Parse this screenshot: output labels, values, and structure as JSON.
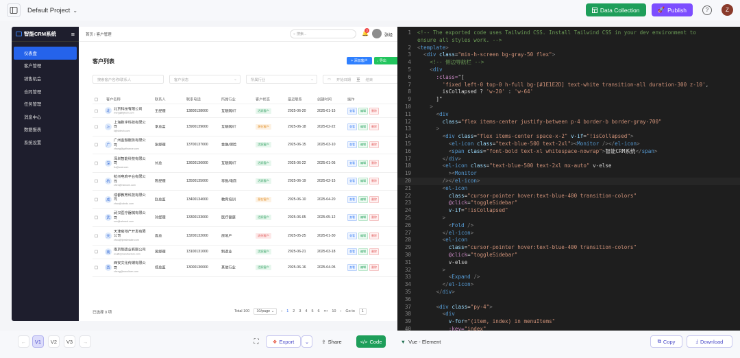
{
  "topbar": {
    "project": "Default Project",
    "data_collection": "Data Collection",
    "publish": "Publish",
    "help": "?",
    "user_initial": "Z"
  },
  "preview": {
    "app_title": "智能CRM系统",
    "menu": [
      "仪表盘",
      "客户管理",
      "销售机会",
      "合同管理",
      "任务管理",
      "消息中心",
      "数据报表",
      "系统设置"
    ],
    "breadcrumb": "首页  /  客户管理",
    "search_placeholder": "搜索...",
    "bell_count": "3",
    "user_name": "张经",
    "page_title": "客户列表",
    "add_customer": "+ 添加客户",
    "export_short": "↓ 导出",
    "filters": {
      "keyword_placeholder": "搜索客户名称/联系人",
      "status_placeholder": "客户状态",
      "industry_placeholder": "所属行业",
      "start_date": "开始日期",
      "to": "至",
      "end_date": "结束"
    },
    "columns": [
      "客户名称",
      "联系人",
      "联系电话",
      "所属行业",
      "客户状态",
      "最近联系",
      "创建时间",
      "操作"
    ],
    "rows": [
      {
        "avatar": "北",
        "name": "北京科技有限公司",
        "email": "wang@bjtech.com",
        "contact": "王经理",
        "phone": "13800138000",
        "industry": "互联网/IT",
        "status": "活跃客户",
        "status_type": "green",
        "last": "2025-06-20",
        "created": "2025-01-15"
      },
      {
        "avatar": "上",
        "name": "上海数字科技有限公司",
        "email": "li@shtech.com",
        "contact": "李总监",
        "phone": "13900139000",
        "industry": "互联网/IT",
        "status": "潜在客户",
        "status_type": "orange",
        "last": "2025-06-18",
        "created": "2025-02-22"
      },
      {
        "avatar": "广",
        "name": "广州金融服务有限公司",
        "email": "zhang@gzfinance.com",
        "contact": "张经理",
        "phone": "13700137000",
        "industry": "金融/保险",
        "status": "活跃客户",
        "status_type": "green",
        "last": "2025-06-15",
        "created": "2025-03-10"
      },
      {
        "avatar": "深",
        "name": "深圳智能科技有限公司",
        "email": "liu@szai.com",
        "contact": "刘总",
        "phone": "13600136000",
        "industry": "互联网/IT",
        "status": "活跃客户",
        "status_type": "green",
        "last": "2025-06-22",
        "created": "2025-01-05"
      },
      {
        "avatar": "杭",
        "name": "杭州电商平台有限公司",
        "email": "chen@hzecom.com",
        "contact": "陈经理",
        "phone": "13500135000",
        "industry": "零售/电商",
        "status": "活跃客户",
        "status_type": "green",
        "last": "2025-06-19",
        "created": "2025-02-15"
      },
      {
        "avatar": "成",
        "name": "成都教育科技有限公司",
        "email": "zhao@cdedu.com",
        "contact": "赵总监",
        "phone": "13400134000",
        "industry": "教育培训",
        "status": "潜在客户",
        "status_type": "orange",
        "last": "2025-06-10",
        "created": "2025-04-20"
      },
      {
        "avatar": "武",
        "name": "武汉医疗器械有限公司",
        "email": "sun@whmed.com",
        "contact": "孙经理",
        "phone": "13300133000",
        "industry": "医疗健康",
        "status": "活跃客户",
        "status_type": "green",
        "last": "2025-06-05",
        "created": "2025-05-12"
      },
      {
        "avatar": "天",
        "name": "天津房地产开发有限公司",
        "email": "zhou@tjrealestate.com",
        "contact": "周总",
        "phone": "13200132000",
        "industry": "房地产",
        "status": "流失客户",
        "status_type": "red",
        "last": "2025-05-25",
        "created": "2025-01-30"
      },
      {
        "avatar": "南",
        "name": "南京制造业有限公司",
        "email": "wu@njmanufacture.com",
        "contact": "吴经理",
        "phone": "13100131000",
        "industry": "制造业",
        "status": "活跃客户",
        "status_type": "green",
        "last": "2025-06-21",
        "created": "2025-03-18"
      },
      {
        "avatar": "西",
        "name": "西安文化传媒有限公司",
        "email": "zheng@xaculture.com",
        "contact": "郑总监",
        "phone": "13000130000",
        "industry": "其他行业",
        "status": "活跃客户",
        "status_type": "green",
        "last": "2025-06-16",
        "created": "2025-04-05"
      }
    ],
    "ops": {
      "view": "查看",
      "edit": "编辑",
      "delete": "删除"
    },
    "selected": "已选择 0 项",
    "pager": {
      "total": "Total 100",
      "page_size": "10/page",
      "prev": "‹",
      "pages": [
        "1",
        "2",
        "3",
        "4",
        "5",
        "6",
        "•••",
        "10"
      ],
      "next": "›",
      "goto": "Go to",
      "goto_value": "1"
    }
  },
  "code": {
    "current_line": 20,
    "lines": [
      "<!-- The exported code uses Tailwind CSS. Install Tailwind CSS in your dev environment to",
      "ensure all styles work. -->",
      "<template>",
      "  <div class=\"min-h-screen bg-gray-50 flex\">",
      "    <!-- 侧边导航栏 -->",
      "    <div",
      "      :class=\"[",
      "        'fixed left-0 top-0 h-full bg-[#1E1E2D] text-white transition-all duration-300 z-10',",
      "        isCollapsed ? 'w-20' : 'w-64'",
      "      ]\"",
      "    >",
      "      <div",
      "        class=\"flex items-center justify-between p-4 border-b border-gray-700\"",
      "      >",
      "        <div class=\"flex items-center space-x-2\" v-if=\"!isCollapsed\">",
      "          <el-icon class=\"text-blue-500 text-2xl\"><Monitor /></el-icon>",
      "          <span class=\"font-bold text-xl whitespace-nowrap\">智能CRM系统</span>",
      "        </div>",
      "        <el-icon class=\"text-blue-500 text-2xl mx-auto\" v-else",
      "          ><Monitor",
      "        /></el-icon>",
      "        <el-icon",
      "          class=\"cursor-pointer hover:text-blue-400 transition-colors\"",
      "          @click=\"toggleSidebar\"",
      "          v-if=\"!isCollapsed\"",
      "        >",
      "          <Fold />",
      "        </el-icon>",
      "        <el-icon",
      "          class=\"cursor-pointer hover:text-blue-400 transition-colors\"",
      "          @click=\"toggleSidebar\"",
      "          v-else",
      "        >",
      "          <Expand />",
      "        </el-icon>",
      "      </div>",
      "",
      "      <div class=\"py-4\">",
      "        <div",
      "          v-for=\"(item, index) in menuItems\"",
      "          :key=\"index\""
    ]
  },
  "bottombar": {
    "prev": "←",
    "versions": [
      "V1",
      "V2",
      "V3"
    ],
    "active_version": "V1",
    "next": "→",
    "export": "Export",
    "share": "Share",
    "code": "Code",
    "framework": "Vue - Element",
    "copy": "Copy",
    "download": "Download"
  },
  "colors": {
    "accent_green": "#1e9e5a",
    "accent_purple": "#7c4dff",
    "sidebar_bg": "#1E1E2D",
    "code_bg": "#1e1e1e"
  }
}
